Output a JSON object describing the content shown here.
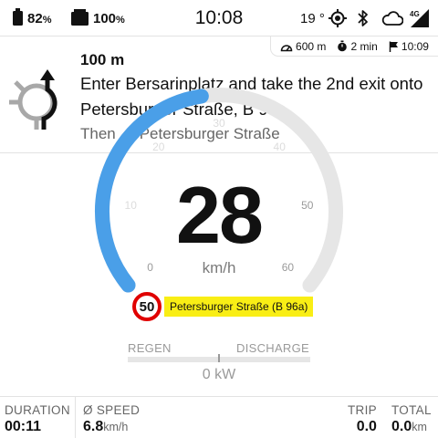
{
  "status": {
    "battery1_pct": "82",
    "battery2_pct": "100",
    "pct_sign": "%",
    "clock": "10:08",
    "temperature": "19 °",
    "network": "4G",
    "icons": [
      "battery-icon",
      "battery-icon",
      "gps-icon",
      "bluetooth-icon",
      "cloud-icon",
      "signal-icon"
    ]
  },
  "trip_info": {
    "distance": "600 m",
    "time": "2 min",
    "eta": "10:09"
  },
  "navigation": {
    "distance": "100 m",
    "instruction": "Enter Bersarinplatz and take the 2nd exit onto Petersburger Straße, B 96a.",
    "then_prefix": "Then",
    "then_arrow": "↑",
    "then_street": "Petersburger Straße",
    "maneuver_icon": "roundabout-icon"
  },
  "speedometer": {
    "speed": "28",
    "unit": "km/h",
    "max": 60,
    "value": 28,
    "ticks": [
      "0",
      "10",
      "20",
      "30",
      "40",
      "50",
      "60"
    ],
    "active_color": "#4a9fe8",
    "track_color": "#e6e6e6"
  },
  "speed_limit": "50",
  "road_name": "Petersburger Straße (B 96a)",
  "regen": {
    "left_label": "REGEN",
    "right_label": "DISCHARGE",
    "power": "0 kW"
  },
  "stats": {
    "duration_label": "DURATION",
    "duration_value": "00:11",
    "avg_label": "Ø SPEED",
    "avg_value": "6.8",
    "avg_unit": "km/h",
    "trip_label": "TRIP",
    "trip_value": "0.0",
    "total_label": "TOTAL",
    "total_value": "0.0",
    "total_unit": "km"
  }
}
